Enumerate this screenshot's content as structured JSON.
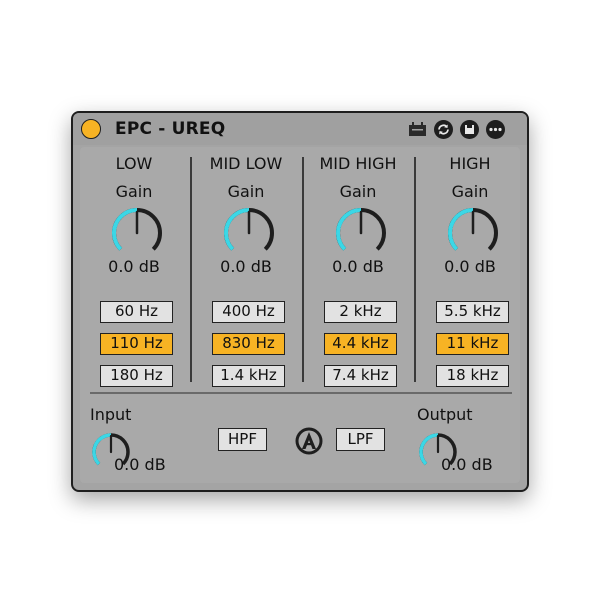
{
  "device": {
    "title": "EPC - UREQ",
    "power_color": "#f7b324"
  },
  "colors": {
    "accent_active": "#f7b324",
    "knob_arc": "#3bd7e6",
    "panel_bg": "#a9a9a9",
    "button_bg": "#e2e2e2"
  },
  "titlebar_icons": [
    "midi-map-icon",
    "hot-swap-icon",
    "save-preset-icon",
    "more-options-icon"
  ],
  "bands": [
    {
      "label": "LOW",
      "gain_label": "Gain",
      "gain_value": "0.0 dB",
      "gain_level": 0.5,
      "freqs": [
        "60 Hz",
        "110 Hz",
        "180 Hz"
      ],
      "selected": 1
    },
    {
      "label": "MID LOW",
      "gain_label": "Gain",
      "gain_value": "0.0 dB",
      "gain_level": 0.5,
      "freqs": [
        "400 Hz",
        "830 Hz",
        "1.4 kHz"
      ],
      "selected": 1
    },
    {
      "label": "MID HIGH",
      "gain_label": "Gain",
      "gain_value": "0.0 dB",
      "gain_level": 0.5,
      "freqs": [
        "2 kHz",
        "4.4 kHz",
        "7.4 kHz"
      ],
      "selected": 1
    },
    {
      "label": "HIGH",
      "gain_label": "Gain",
      "gain_value": "0.0 dB",
      "gain_level": 0.5,
      "freqs": [
        "5.5 kHz",
        "11 kHz",
        "18 kHz"
      ],
      "selected": 1
    }
  ],
  "input": {
    "label": "Input",
    "value": "0.0 dB",
    "level": 0.5
  },
  "output": {
    "label": "Output",
    "value": "0.0 dB",
    "level": 0.5
  },
  "filters": {
    "hpf_label": "HPF",
    "lpf_label": "LPF"
  }
}
